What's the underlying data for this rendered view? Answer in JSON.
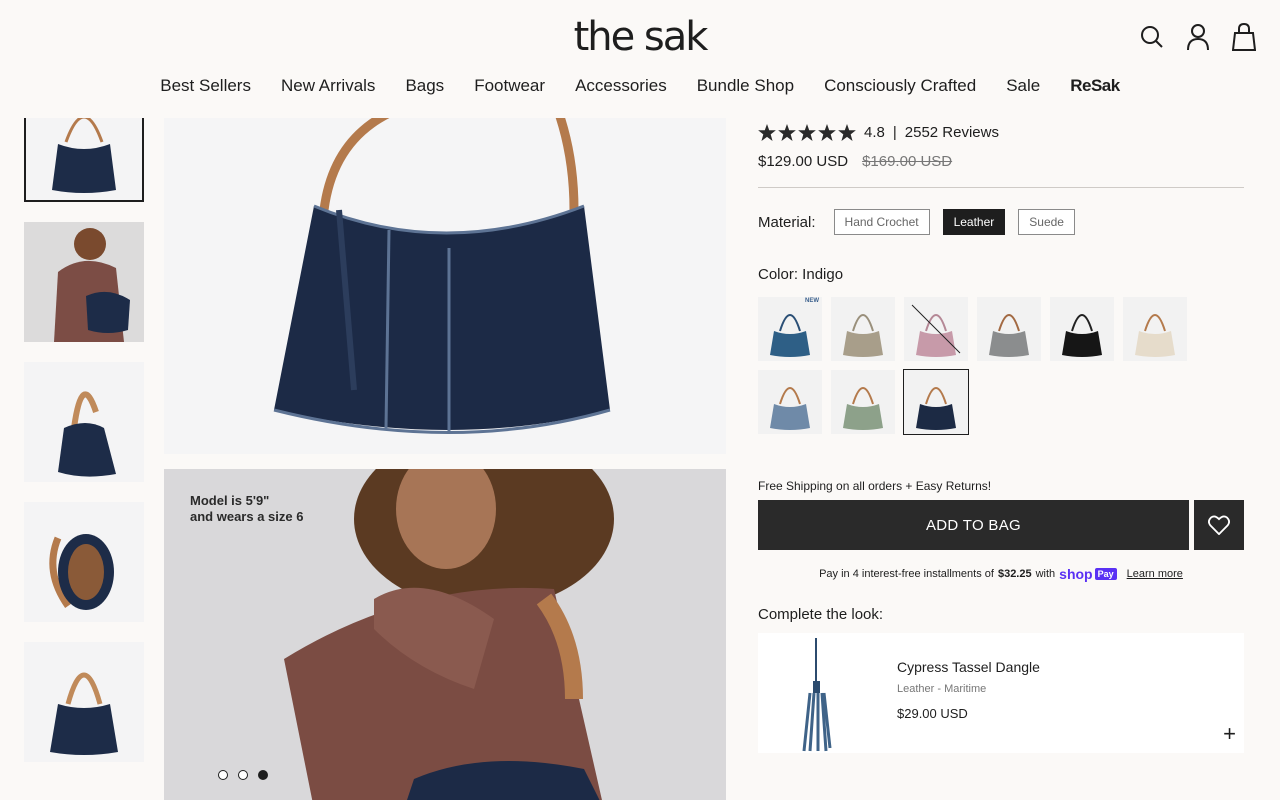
{
  "header": {
    "logo": "the sak",
    "icons": [
      "search-icon",
      "account-icon",
      "bag-icon"
    ]
  },
  "nav": [
    {
      "label": "Best Sellers"
    },
    {
      "label": "New Arrivals"
    },
    {
      "label": "Bags"
    },
    {
      "label": "Footwear"
    },
    {
      "label": "Accessories"
    },
    {
      "label": "Bundle Shop"
    },
    {
      "label": "Consciously Crafted"
    },
    {
      "label": "Sale"
    },
    {
      "label": "ReSak"
    }
  ],
  "gallery": {
    "model_note": "Model is 5'9\"\nand wears a size 6",
    "thumbnail_count": 5,
    "active_thumbnail": 1
  },
  "product": {
    "rating_value": "4.8",
    "rating_separator": "|",
    "reviews": "2552 Reviews",
    "price": "$129.00 USD",
    "old_price": "$169.00 USD",
    "material_label": "Material:",
    "materials": [
      {
        "label": "Hand Crochet",
        "selected": false
      },
      {
        "label": "Leather",
        "selected": true
      },
      {
        "label": "Suede",
        "selected": false
      }
    ],
    "color_label": "Color: Indigo",
    "new_badge": "NEW",
    "colors": [
      {
        "bag": "#2e5f86",
        "strap": "#2b4f76",
        "new": true
      },
      {
        "bag": "#a89e8a",
        "strap": "#9a907c"
      },
      {
        "bag": "#c79aa9",
        "strap": "#b58896",
        "crossed": true
      },
      {
        "bag": "#8b8d8e",
        "strap": "#a36a43"
      },
      {
        "bag": "#161616",
        "strap": "#222222"
      },
      {
        "bag": "#e6dccb",
        "strap": "#b47a4c"
      },
      {
        "bag": "#6f8aa8",
        "strap": "#b47a4c"
      },
      {
        "bag": "#8da18a",
        "strap": "#b47a4c"
      },
      {
        "bag": "#1c2a44",
        "strap": "#b47a4c",
        "selected": true
      }
    ],
    "shipping": "Free Shipping on all orders + Easy Returns!",
    "add_to_bag": "ADD TO BAG",
    "pay_text": "Pay in 4 interest-free installments of",
    "pay_amount": "$32.25",
    "pay_with": "with",
    "shoppay_brand": "shop",
    "shoppay_badge": "Pay",
    "learn_more": "Learn more"
  },
  "complete_look": {
    "title": "Complete the look:",
    "item_name": "Cypress Tassel Dangle",
    "item_variant": "Leather - Maritime",
    "item_price": "$29.00 USD",
    "add_symbol": "+",
    "carousel_pages": 3,
    "carousel_active": 3
  },
  "colors": {
    "accent": "#2a2a2a",
    "shoppay": "#5a31f4",
    "indigo": "#1c2a44"
  }
}
